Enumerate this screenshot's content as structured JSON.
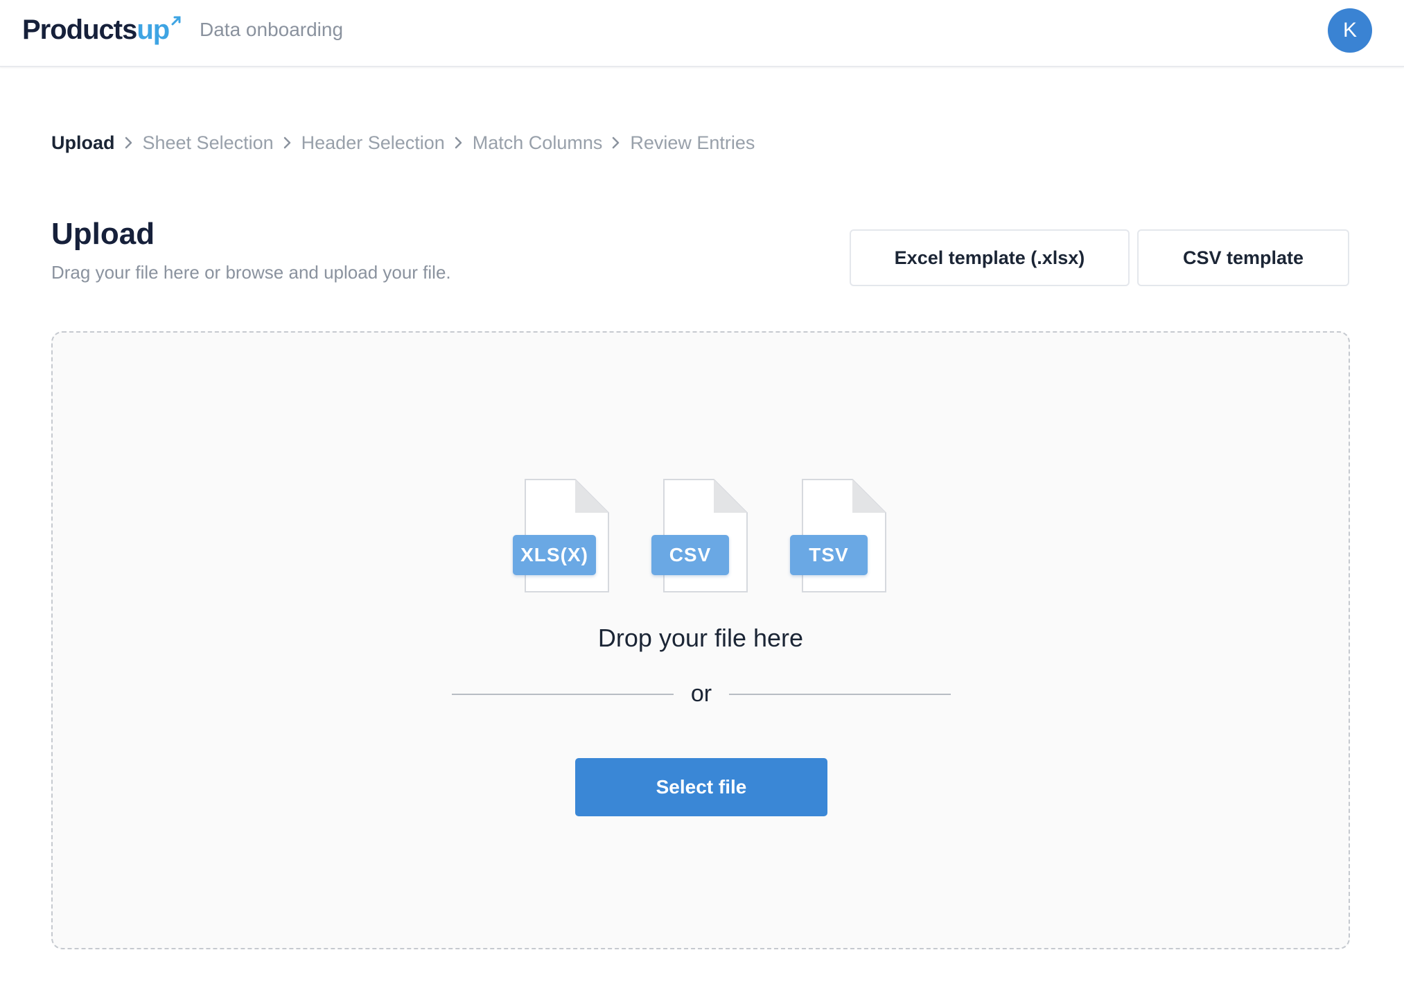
{
  "header": {
    "logo_main": "Products",
    "logo_accent": "up",
    "app_name": "Data onboarding",
    "avatar_initial": "K"
  },
  "breadcrumb": {
    "steps": [
      "Upload",
      "Sheet Selection",
      "Header Selection",
      "Match Columns",
      "Review Entries"
    ],
    "active_index": 0
  },
  "page": {
    "title": "Upload",
    "subtitle": "Drag your file here or browse and upload your file.",
    "excel_template_label": "Excel template (.xlsx)",
    "csv_template_label": "CSV template"
  },
  "dropzone": {
    "file_types": [
      "XLS(X)",
      "CSV",
      "TSV"
    ],
    "drop_label": "Drop your file here",
    "or_label": "or",
    "select_button_label": "Select file"
  },
  "colors": {
    "brand_dark": "#16203a",
    "brand_accent": "#3ea4e3",
    "primary_button": "#3a87d6",
    "file_tag": "#6aa8e4",
    "avatar": "#3a83d3"
  }
}
